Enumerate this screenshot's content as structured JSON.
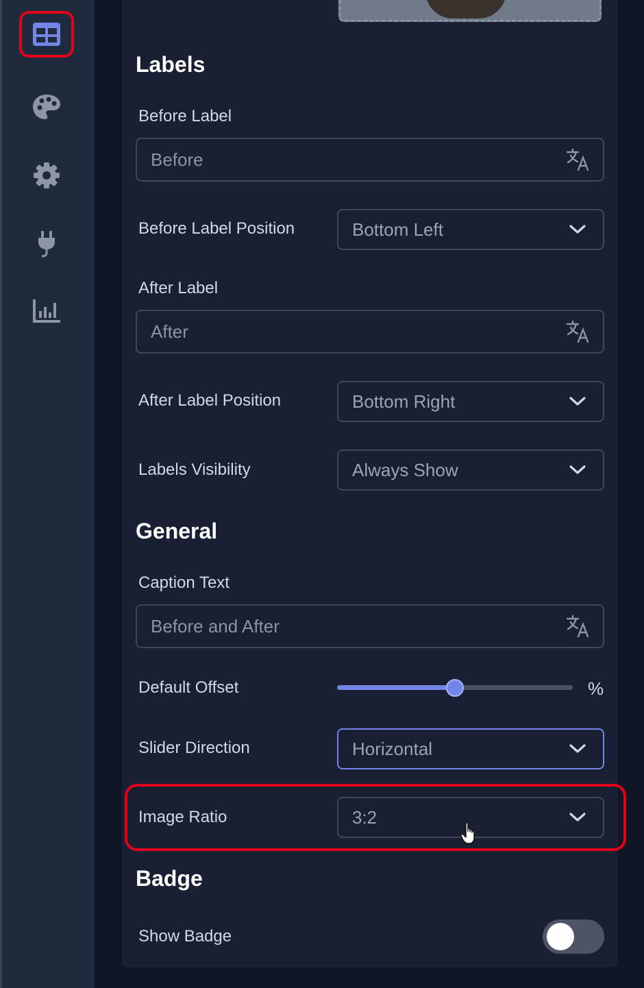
{
  "sidebar": {
    "items": [
      {
        "icon": "layout-grid-icon",
        "active": true
      },
      {
        "icon": "palette-icon",
        "active": false
      },
      {
        "icon": "gear-icon",
        "active": false
      },
      {
        "icon": "plug-icon",
        "active": false
      },
      {
        "icon": "bar-chart-icon",
        "active": false
      }
    ],
    "accent": "#7386e8",
    "icon_color": "#8d96a8"
  },
  "labels_section": {
    "title": "Labels",
    "before_label": {
      "label": "Before Label",
      "placeholder": "Before"
    },
    "before_label_position": {
      "label": "Before Label Position",
      "value": "Bottom Left"
    },
    "after_label": {
      "label": "After Label",
      "placeholder": "After"
    },
    "after_label_position": {
      "label": "After Label Position",
      "value": "Bottom Right"
    },
    "labels_visibility": {
      "label": "Labels Visibility",
      "value": "Always Show"
    }
  },
  "general_section": {
    "title": "General",
    "caption_text": {
      "label": "Caption Text",
      "placeholder": "Before and After"
    },
    "default_offset": {
      "label": "Default Offset",
      "unit": "%",
      "level": 0.5
    },
    "slider_direction": {
      "label": "Slider Direction",
      "value": "Horizontal"
    },
    "image_ratio": {
      "label": "Image Ratio",
      "value": "3:2"
    }
  },
  "badge_section": {
    "title": "Badge",
    "show_badge": {
      "label": "Show Badge",
      "enabled": false
    }
  },
  "highlight_color": "#e3001b"
}
